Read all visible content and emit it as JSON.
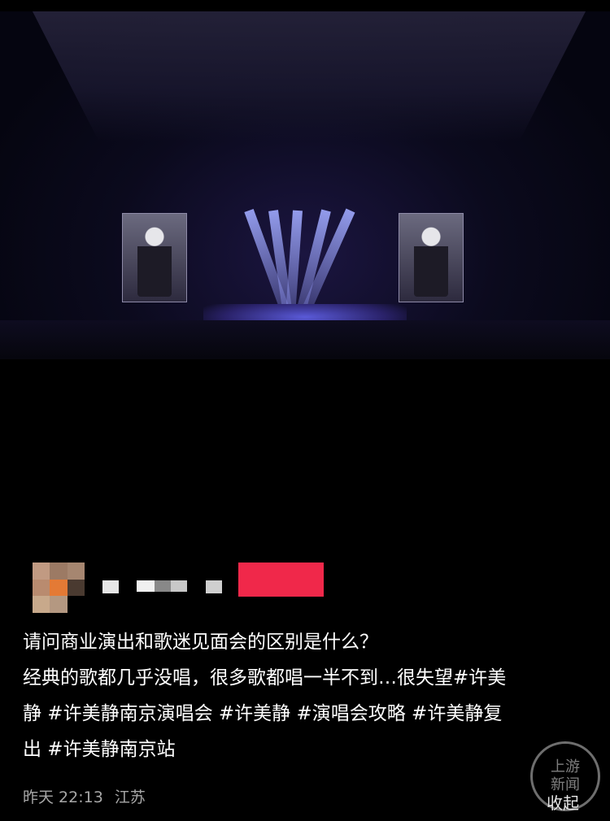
{
  "post": {
    "lines": [
      "请问商业演出和歌迷见面会的区别是什么？",
      "经典的歌都几乎没唱，很多歌都唱一半不到…很失望#许美",
      "静 #许美静南京演唱会 #许美静 #演唱会攻略 #许美静复",
      "出 #许美静南京站"
    ]
  },
  "meta": {
    "time": "昨天 22:13",
    "location": "江苏"
  },
  "actions": {
    "collapse": "收起"
  },
  "watermark": {
    "line1": "上游",
    "line2": "新闻"
  },
  "colors": {
    "badge": "#f0284a",
    "meta_text": "#a7a7a7"
  }
}
